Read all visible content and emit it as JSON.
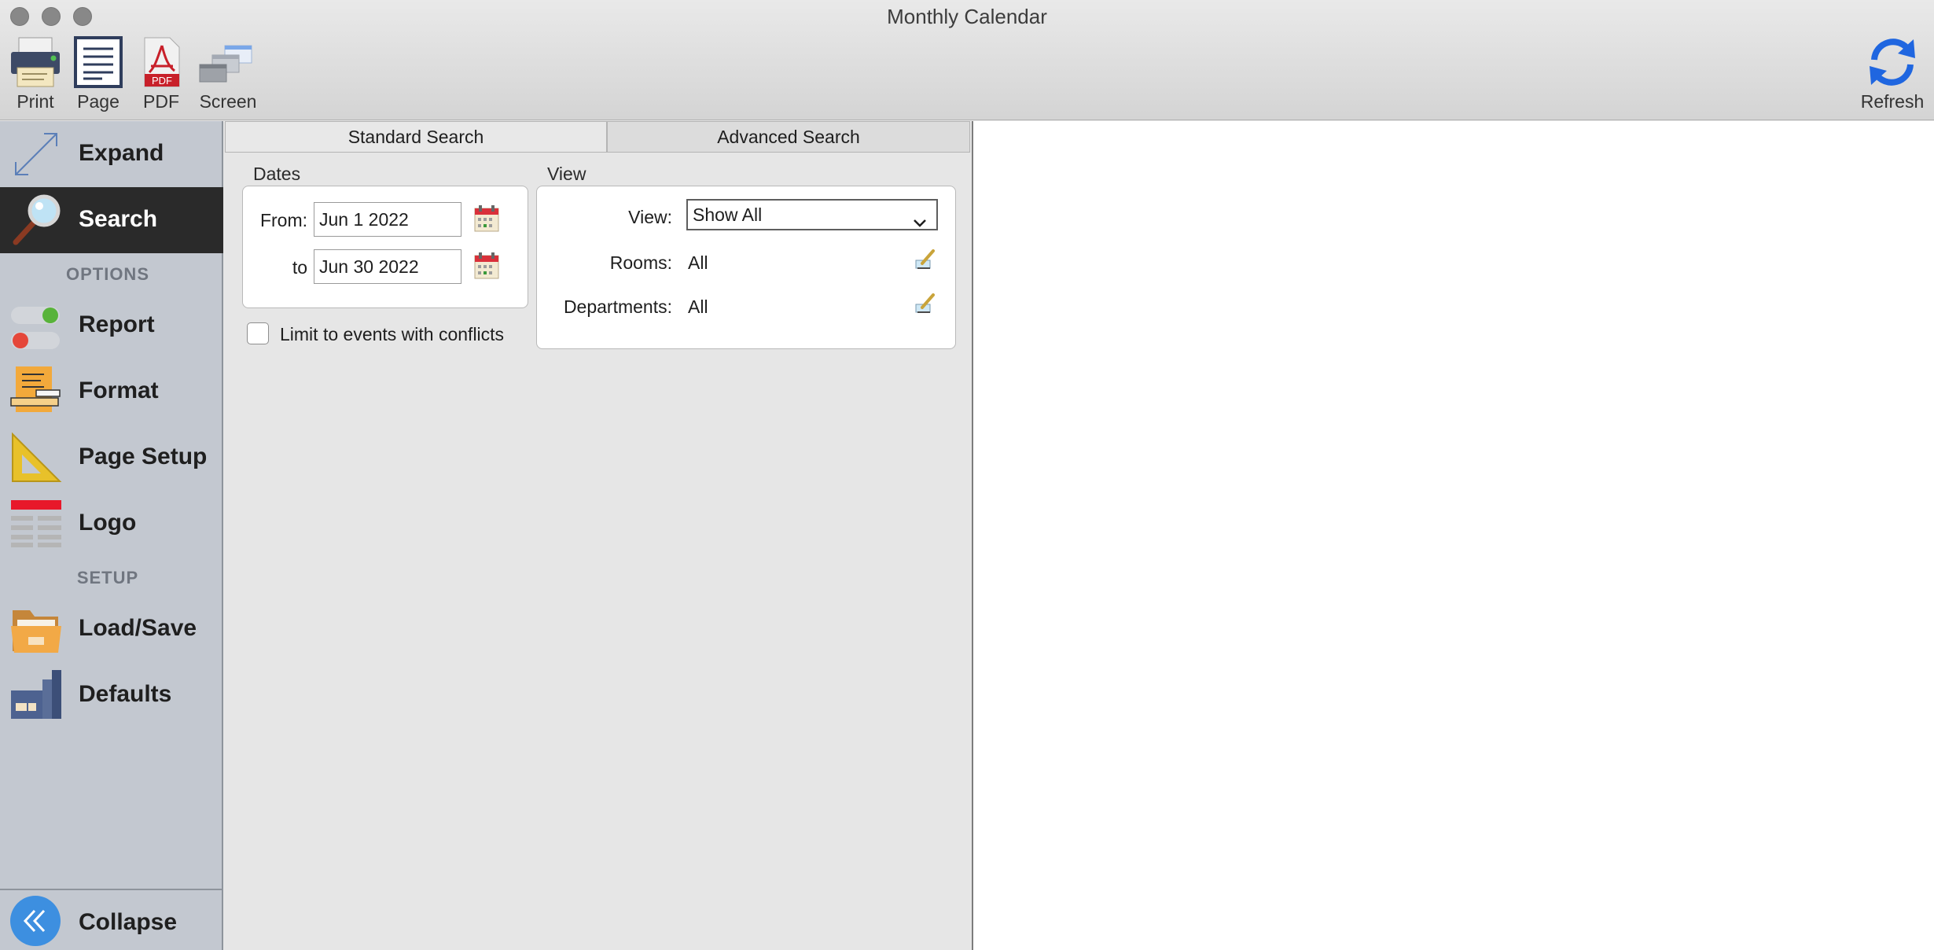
{
  "window": {
    "title": "Monthly Calendar"
  },
  "toolbar": {
    "print_label": "Print",
    "page_label": "Page",
    "pdf_label": "PDF",
    "pdf_badge": "PDF",
    "screen_label": "Screen",
    "refresh_label": "Refresh"
  },
  "sidebar": {
    "expand_label": "Expand",
    "search_label": "Search",
    "options_header": "OPTIONS",
    "report_label": "Report",
    "format_label": "Format",
    "page_setup_label": "Page Setup",
    "logo_label": "Logo",
    "setup_header": "SETUP",
    "load_save_label": "Load/Save",
    "defaults_label": "Defaults",
    "collapse_label": "Collapse"
  },
  "tabs": {
    "standard": "Standard Search",
    "advanced": "Advanced Search"
  },
  "dates": {
    "group_label": "Dates",
    "from_label": "From:",
    "from_value": "Jun 1 2022",
    "to_label": "to",
    "to_value": "Jun 30 2022"
  },
  "conflicts": {
    "label": "Limit to events with conflicts",
    "checked": false
  },
  "view": {
    "group_label": "View",
    "view_label": "View:",
    "view_value": "Show All",
    "rooms_label": "Rooms:",
    "rooms_value": "All",
    "departments_label": "Departments:",
    "departments_value": "All"
  },
  "colors": {
    "sidebar_bg": "#c3c8d0",
    "active_bg": "#2a2a2a",
    "accent_blue": "#1f66e0",
    "collapse_blue": "#3d8fe0"
  }
}
